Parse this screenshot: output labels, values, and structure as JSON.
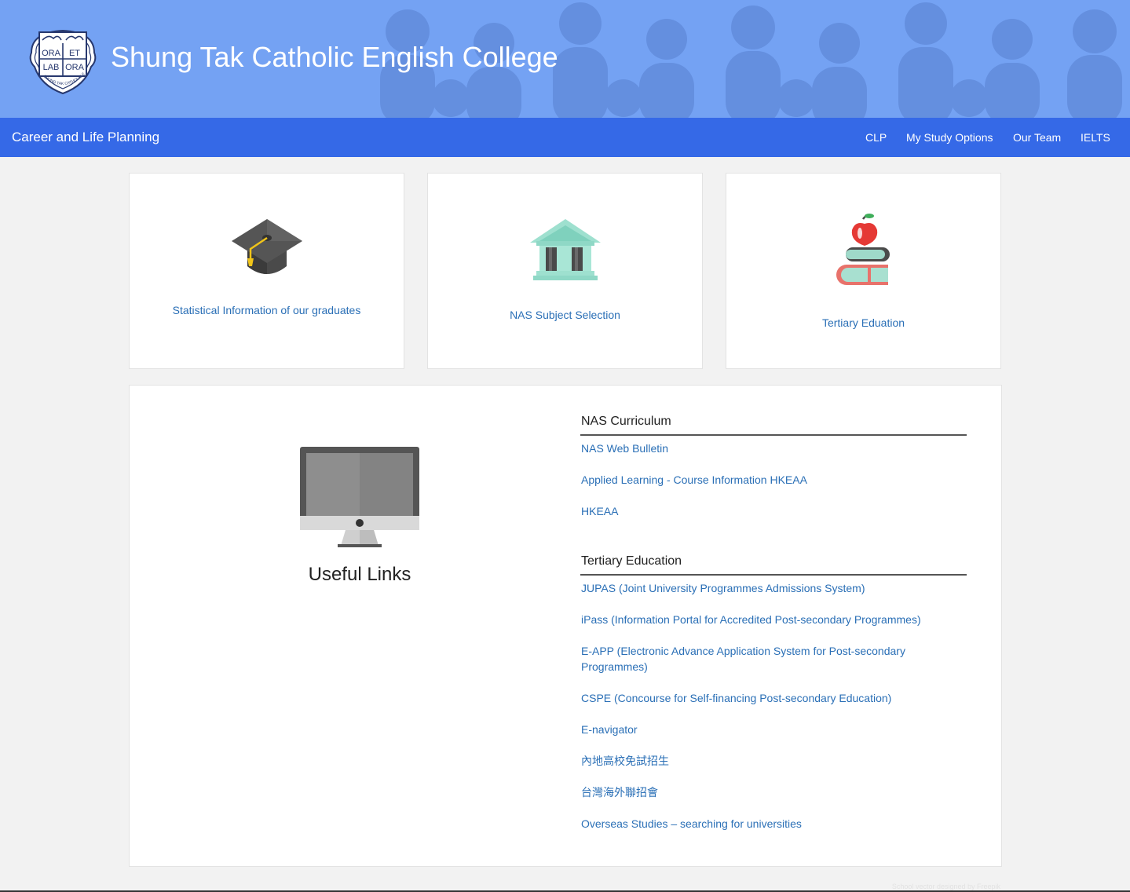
{
  "header": {
    "title": "Shung Tak Catholic English College",
    "logo": {
      "texts": [
        "ORA",
        "ET",
        "LAB",
        "ORA"
      ],
      "ring_text": "SHUNG TAK CATHOLIC ENGLISH COLLEGE"
    }
  },
  "navbar": {
    "brand": "Career and Life Planning",
    "items": [
      {
        "label": "CLP"
      },
      {
        "label": "My Study Options"
      },
      {
        "label": "Our Team"
      },
      {
        "label": "IELTS"
      }
    ]
  },
  "cards": [
    {
      "icon": "graduation-cap-icon",
      "label": "Statistical Information of our graduates"
    },
    {
      "icon": "bank-building-icon",
      "label": "NAS Subject Selection"
    },
    {
      "icon": "apple-books-icon",
      "label": "Tertiary Eduation"
    }
  ],
  "useful_links": {
    "title": "Useful Links",
    "icon": "computer-monitor-icon",
    "sections": [
      {
        "heading": "NAS Curriculum",
        "links": [
          "NAS Web Bulletin",
          "Applied Learning - Course Information HKEAA",
          "HKEAA"
        ]
      },
      {
        "heading": "Tertiary Education",
        "links": [
          "JUPAS (Joint University Programmes Admissions System)",
          "iPass (Information Portal for Accredited Post-secondary Programmes)",
          "E-APP (Electronic Advance Application System for Post-secondary Programmes)",
          "CSPE (Concourse for Self-financing Post-secondary Education)",
          "E-navigator",
          "內地高校免試招生",
          "台灣海外聯招會",
          "Overseas Studies – searching for universities"
        ]
      }
    ]
  },
  "footer": {
    "credit": "School vector designed by Freepik"
  },
  "colors": {
    "header_bg": "#74a2f3",
    "navbar_bg": "#3569e7",
    "link": "#2a6fb6",
    "page_bg": "#f2f2f2"
  }
}
